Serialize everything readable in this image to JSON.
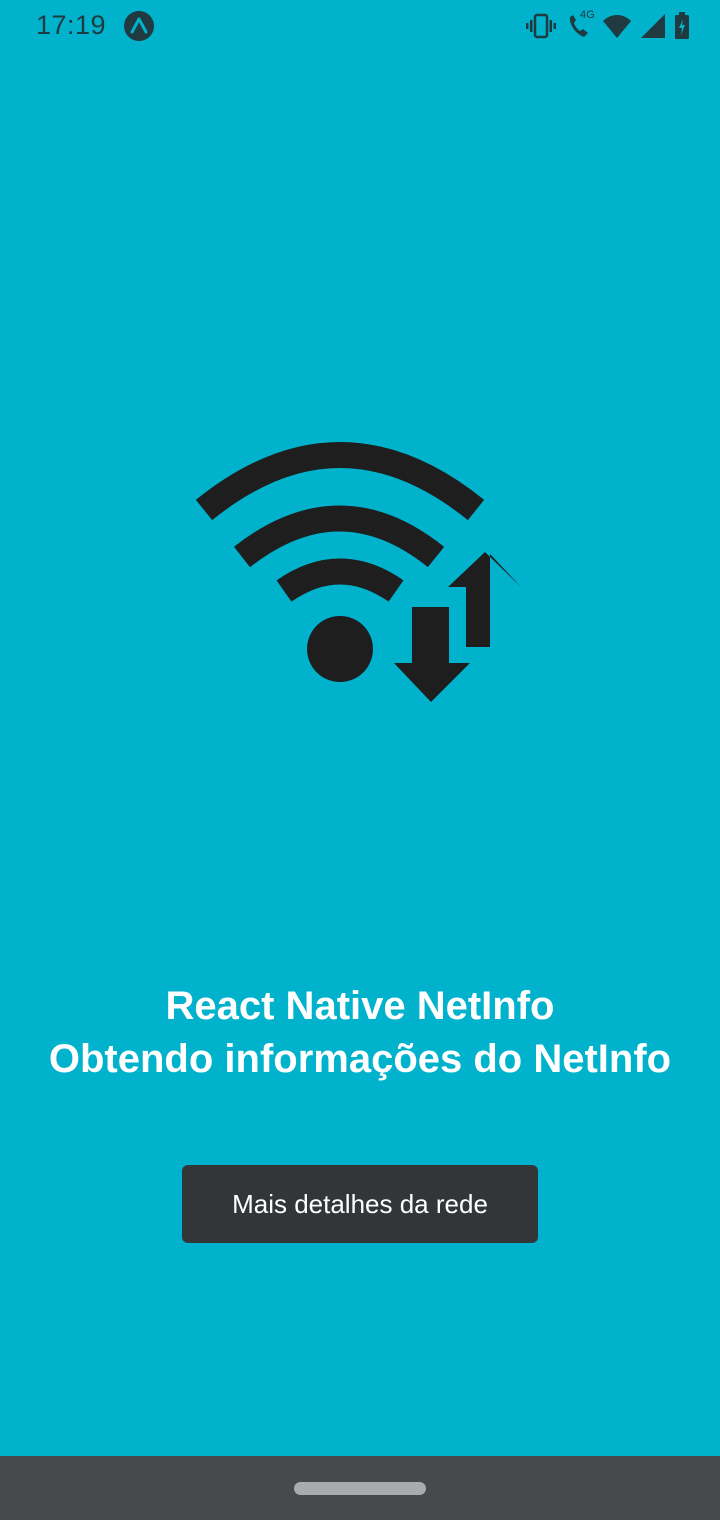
{
  "status_bar": {
    "time": "17:19",
    "network_type": "4G",
    "icons": [
      "expo-icon",
      "vibrate-icon",
      "call-signal-icon",
      "wifi-icon",
      "cell-signal-icon",
      "battery-charging-icon"
    ]
  },
  "hero": {
    "icon": "wifi-transfer-icon"
  },
  "title": {
    "line1": "React Native NetInfo",
    "line2": "Obtendo informações do NetInfo"
  },
  "button": {
    "label": "Mais detalhes da rede"
  },
  "colors": {
    "background": "#00B2CC",
    "button_bg": "#333638",
    "nav_bar": "#474A4D",
    "icon": "#1E1E1E"
  }
}
